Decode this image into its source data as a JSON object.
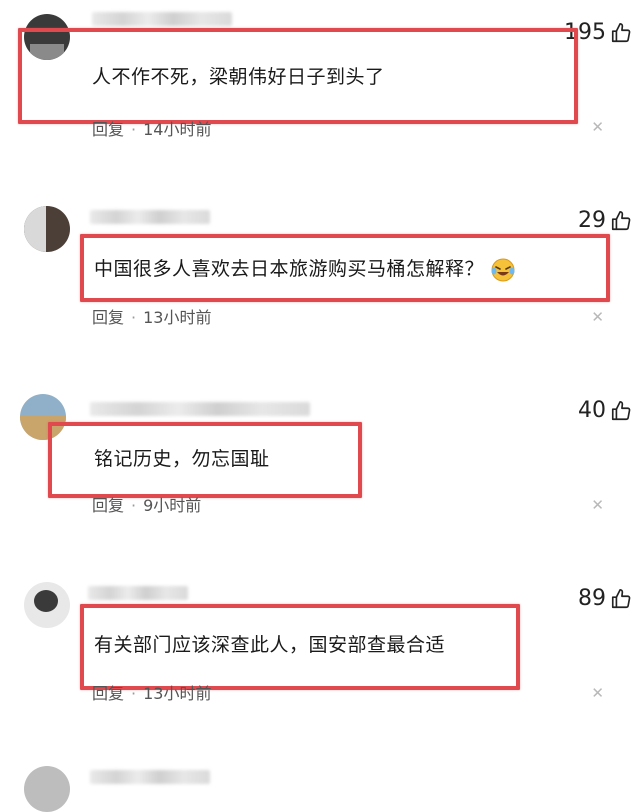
{
  "comments": [
    {
      "likes": "195",
      "text": "人不作不死，梁朝伟好日子到头了",
      "reply_label": "回复",
      "time": "14小时前"
    },
    {
      "likes": "29",
      "text": "中国很多人喜欢去日本旅游购买马桶怎解释？",
      "emoji": "laughing-crying-emoji",
      "reply_label": "回复",
      "time": "13小时前"
    },
    {
      "likes": "40",
      "text": "铭记历史，勿忘国耻",
      "reply_label": "回复",
      "time": "9小时前"
    },
    {
      "likes": "89",
      "text": "有关部门应该深查此人，国安部查最合适",
      "reply_label": "回复",
      "time": "13小时前"
    }
  ],
  "colors": {
    "highlight_border": "#e04a4f",
    "meta_text": "#555555",
    "close_icon": "#b9b9b9"
  },
  "icons": {
    "like": "thumbs-up-icon",
    "dismiss": "close-icon"
  }
}
